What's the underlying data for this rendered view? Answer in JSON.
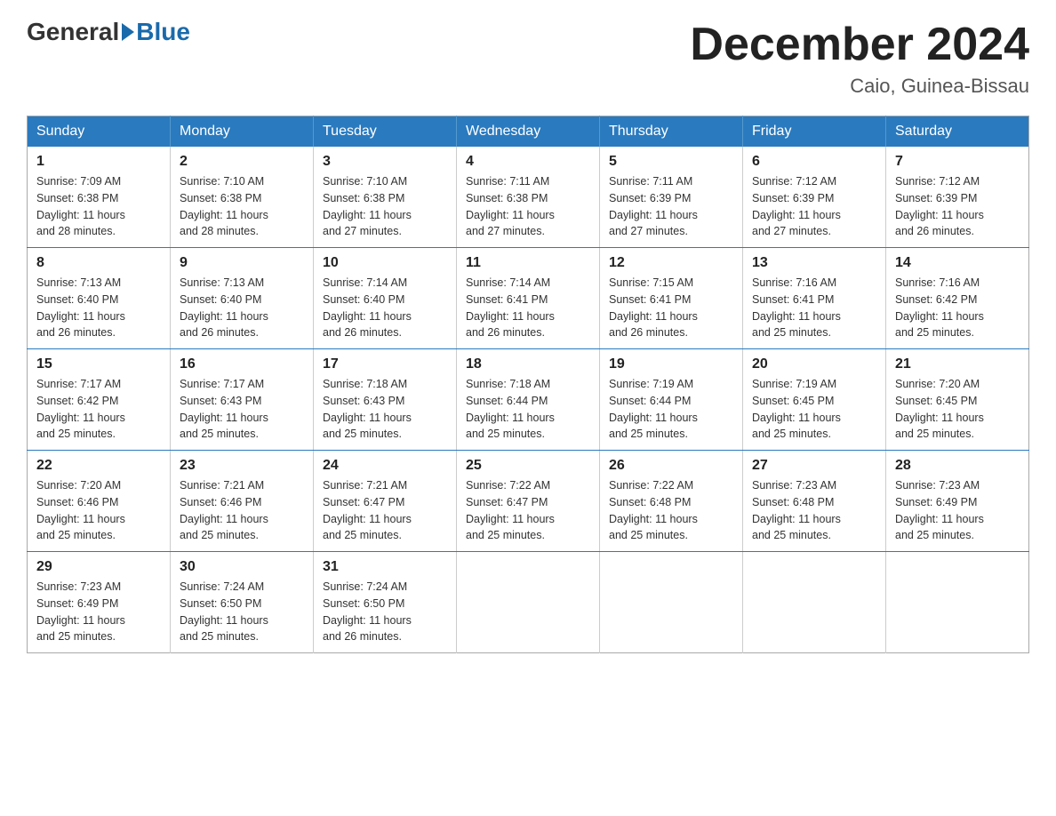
{
  "header": {
    "logo_general": "General",
    "logo_blue": "Blue",
    "month_title": "December 2024",
    "location": "Caio, Guinea-Bissau"
  },
  "calendar": {
    "days_of_week": [
      "Sunday",
      "Monday",
      "Tuesday",
      "Wednesday",
      "Thursday",
      "Friday",
      "Saturday"
    ],
    "weeks": [
      [
        {
          "day": "1",
          "sunrise": "7:09 AM",
          "sunset": "6:38 PM",
          "daylight": "11 hours and 28 minutes."
        },
        {
          "day": "2",
          "sunrise": "7:10 AM",
          "sunset": "6:38 PM",
          "daylight": "11 hours and 28 minutes."
        },
        {
          "day": "3",
          "sunrise": "7:10 AM",
          "sunset": "6:38 PM",
          "daylight": "11 hours and 27 minutes."
        },
        {
          "day": "4",
          "sunrise": "7:11 AM",
          "sunset": "6:38 PM",
          "daylight": "11 hours and 27 minutes."
        },
        {
          "day": "5",
          "sunrise": "7:11 AM",
          "sunset": "6:39 PM",
          "daylight": "11 hours and 27 minutes."
        },
        {
          "day": "6",
          "sunrise": "7:12 AM",
          "sunset": "6:39 PM",
          "daylight": "11 hours and 27 minutes."
        },
        {
          "day": "7",
          "sunrise": "7:12 AM",
          "sunset": "6:39 PM",
          "daylight": "11 hours and 26 minutes."
        }
      ],
      [
        {
          "day": "8",
          "sunrise": "7:13 AM",
          "sunset": "6:40 PM",
          "daylight": "11 hours and 26 minutes."
        },
        {
          "day": "9",
          "sunrise": "7:13 AM",
          "sunset": "6:40 PM",
          "daylight": "11 hours and 26 minutes."
        },
        {
          "day": "10",
          "sunrise": "7:14 AM",
          "sunset": "6:40 PM",
          "daylight": "11 hours and 26 minutes."
        },
        {
          "day": "11",
          "sunrise": "7:14 AM",
          "sunset": "6:41 PM",
          "daylight": "11 hours and 26 minutes."
        },
        {
          "day": "12",
          "sunrise": "7:15 AM",
          "sunset": "6:41 PM",
          "daylight": "11 hours and 26 minutes."
        },
        {
          "day": "13",
          "sunrise": "7:16 AM",
          "sunset": "6:41 PM",
          "daylight": "11 hours and 25 minutes."
        },
        {
          "day": "14",
          "sunrise": "7:16 AM",
          "sunset": "6:42 PM",
          "daylight": "11 hours and 25 minutes."
        }
      ],
      [
        {
          "day": "15",
          "sunrise": "7:17 AM",
          "sunset": "6:42 PM",
          "daylight": "11 hours and 25 minutes."
        },
        {
          "day": "16",
          "sunrise": "7:17 AM",
          "sunset": "6:43 PM",
          "daylight": "11 hours and 25 minutes."
        },
        {
          "day": "17",
          "sunrise": "7:18 AM",
          "sunset": "6:43 PM",
          "daylight": "11 hours and 25 minutes."
        },
        {
          "day": "18",
          "sunrise": "7:18 AM",
          "sunset": "6:44 PM",
          "daylight": "11 hours and 25 minutes."
        },
        {
          "day": "19",
          "sunrise": "7:19 AM",
          "sunset": "6:44 PM",
          "daylight": "11 hours and 25 minutes."
        },
        {
          "day": "20",
          "sunrise": "7:19 AM",
          "sunset": "6:45 PM",
          "daylight": "11 hours and 25 minutes."
        },
        {
          "day": "21",
          "sunrise": "7:20 AM",
          "sunset": "6:45 PM",
          "daylight": "11 hours and 25 minutes."
        }
      ],
      [
        {
          "day": "22",
          "sunrise": "7:20 AM",
          "sunset": "6:46 PM",
          "daylight": "11 hours and 25 minutes."
        },
        {
          "day": "23",
          "sunrise": "7:21 AM",
          "sunset": "6:46 PM",
          "daylight": "11 hours and 25 minutes."
        },
        {
          "day": "24",
          "sunrise": "7:21 AM",
          "sunset": "6:47 PM",
          "daylight": "11 hours and 25 minutes."
        },
        {
          "day": "25",
          "sunrise": "7:22 AM",
          "sunset": "6:47 PM",
          "daylight": "11 hours and 25 minutes."
        },
        {
          "day": "26",
          "sunrise": "7:22 AM",
          "sunset": "6:48 PM",
          "daylight": "11 hours and 25 minutes."
        },
        {
          "day": "27",
          "sunrise": "7:23 AM",
          "sunset": "6:48 PM",
          "daylight": "11 hours and 25 minutes."
        },
        {
          "day": "28",
          "sunrise": "7:23 AM",
          "sunset": "6:49 PM",
          "daylight": "11 hours and 25 minutes."
        }
      ],
      [
        {
          "day": "29",
          "sunrise": "7:23 AM",
          "sunset": "6:49 PM",
          "daylight": "11 hours and 25 minutes."
        },
        {
          "day": "30",
          "sunrise": "7:24 AM",
          "sunset": "6:50 PM",
          "daylight": "11 hours and 25 minutes."
        },
        {
          "day": "31",
          "sunrise": "7:24 AM",
          "sunset": "6:50 PM",
          "daylight": "11 hours and 26 minutes."
        },
        null,
        null,
        null,
        null
      ]
    ],
    "sunrise_label": "Sunrise:",
    "sunset_label": "Sunset:",
    "daylight_label": "Daylight:"
  }
}
